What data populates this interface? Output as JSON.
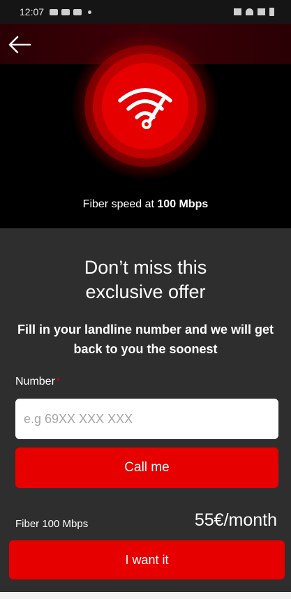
{
  "status_bar": {
    "time": "12:07"
  },
  "hero": {
    "caption_prefix": "Fiber speed at ",
    "caption_speed": "100 Mbps"
  },
  "icons": {
    "back": "arrow-left-icon",
    "speed": "wifi-speedometer-icon"
  },
  "offer": {
    "title_line1": "Don’t miss this",
    "title_line2": "exclusive offer",
    "subtitle": "Fill in your landline number and we will get back to you the soonest"
  },
  "form": {
    "number_label": "Number",
    "required_mark": "*",
    "number_placeholder": "e.g 69XX XXX XXX",
    "number_value": "",
    "call_button": "Call me"
  },
  "plan": {
    "name": "Fiber 100 Mbps",
    "price": "55€/month",
    "cta": "I want it"
  },
  "colors": {
    "brand_red": "#e60000",
    "background": "#2e2e2e",
    "hero_background": "#000000"
  }
}
